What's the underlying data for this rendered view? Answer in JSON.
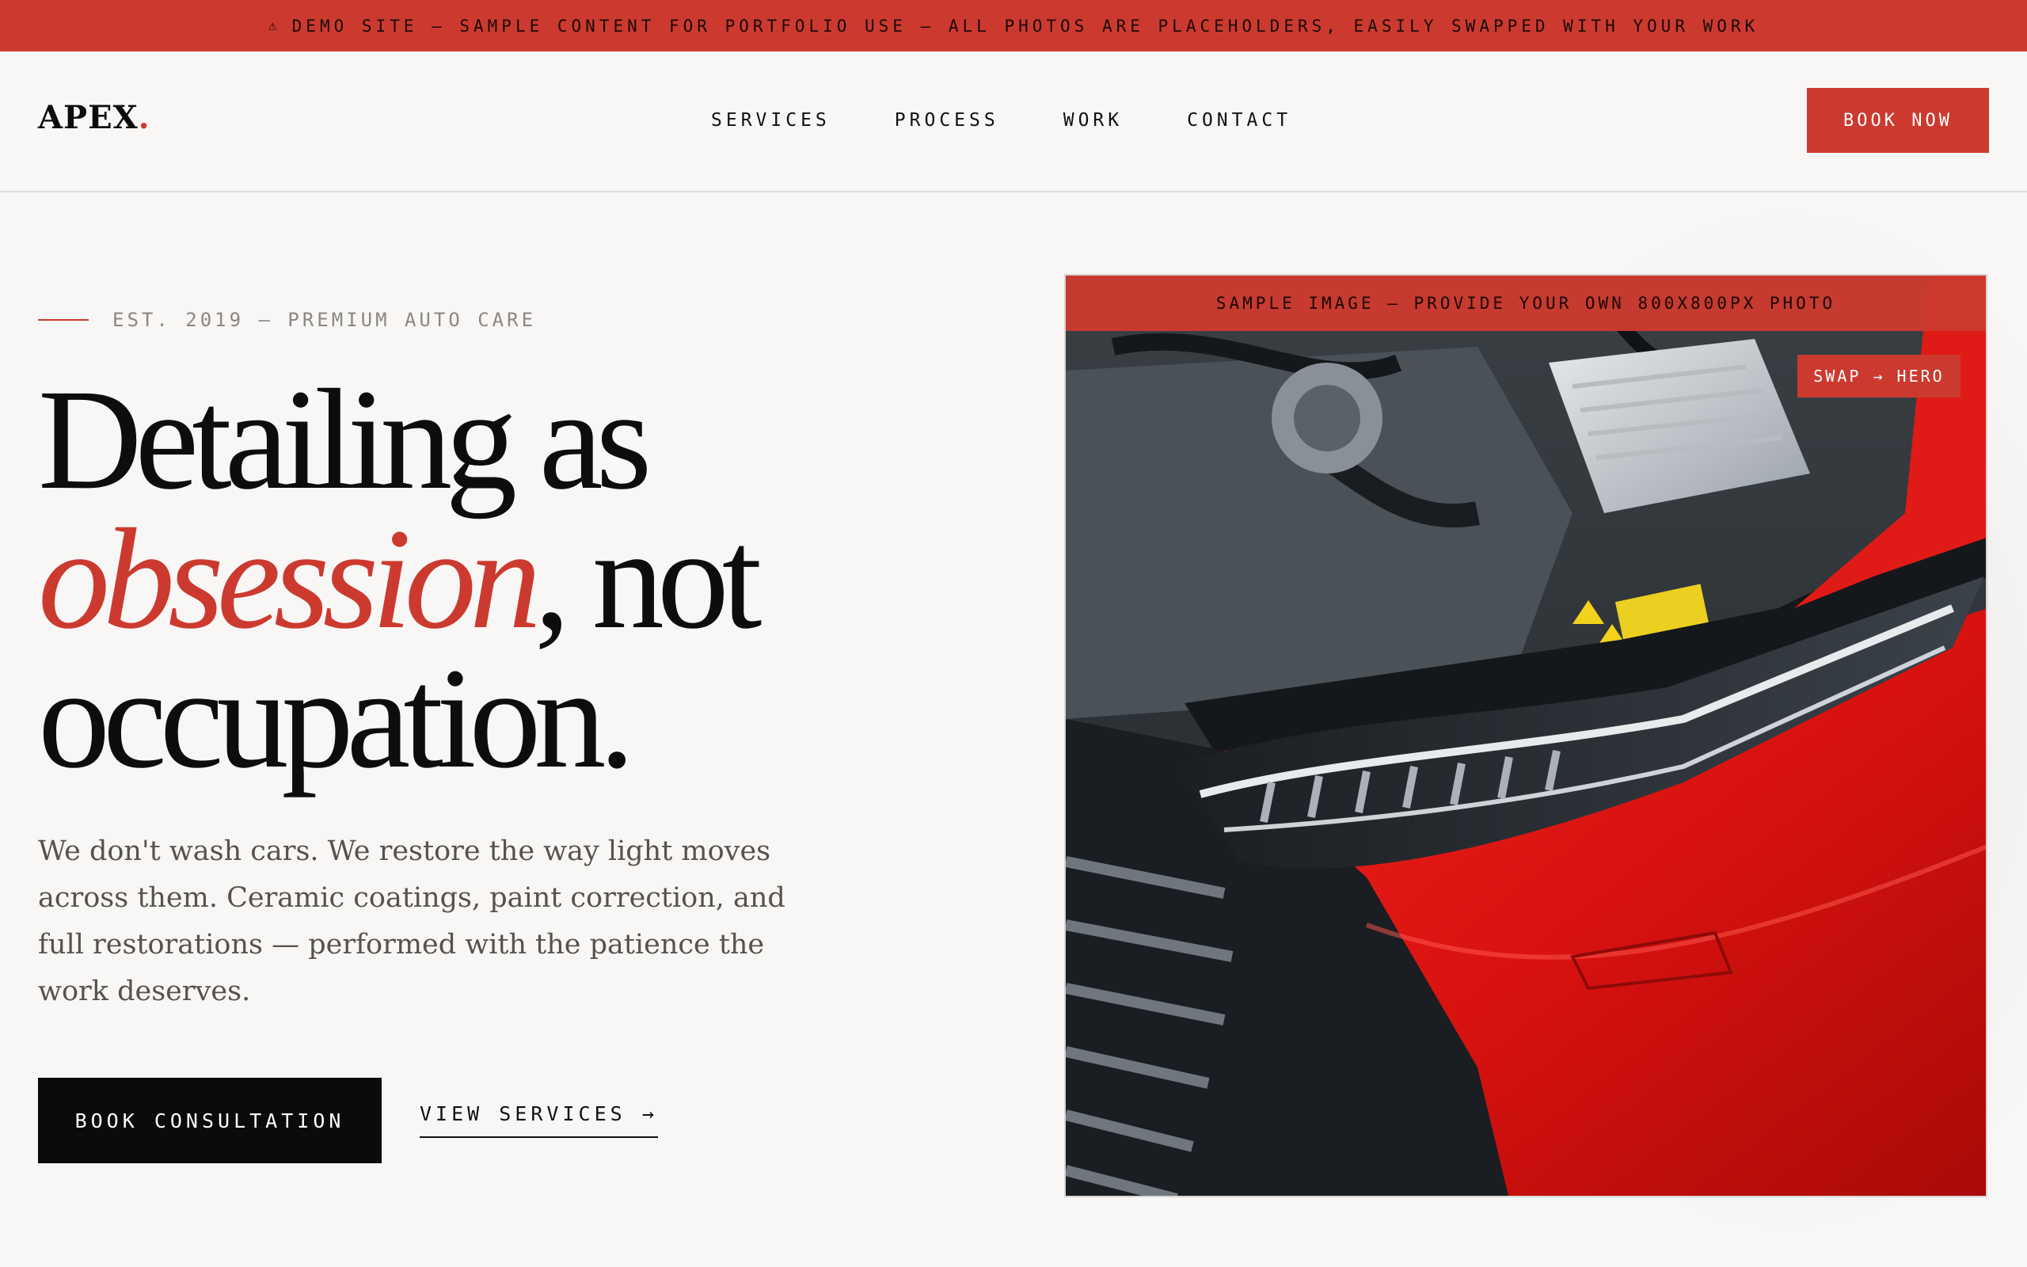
{
  "banner": {
    "icon": "warning-icon",
    "text": "DEMO SITE — SAMPLE CONTENT FOR PORTFOLIO USE — ALL PHOTOS ARE PLACEHOLDERS, EASILY SWAPPED WITH YOUR WORK"
  },
  "brand": {
    "name": "APEX",
    "dot": "."
  },
  "nav": {
    "items": [
      "SERVICES",
      "PROCESS",
      "WORK",
      "CONTACT"
    ],
    "cta": "BOOK NOW"
  },
  "hero": {
    "eyebrow": "EST. 2019 — PREMIUM AUTO CARE",
    "headline": {
      "line1": "Detailing as",
      "accent": "obsession",
      "line2_rest": ", not",
      "line3": "occupation."
    },
    "lede": "We don't wash cars. We restore the way light moves across them. Ceramic coatings, paint correction, and full restorations — performed with the patience the work deserves.",
    "primary_cta": "BOOK CONSULTATION",
    "secondary_cta": "VIEW SERVICES →",
    "image_caption": "SAMPLE IMAGE — PROVIDE YOUR OWN 800X800PX PHOTO",
    "image_tag": "SWAP → HERO"
  },
  "colors": {
    "accent": "#cc3a2f",
    "ink": "#0d0d0d",
    "background": "#f8f7f6",
    "muted": "#8a8784"
  }
}
